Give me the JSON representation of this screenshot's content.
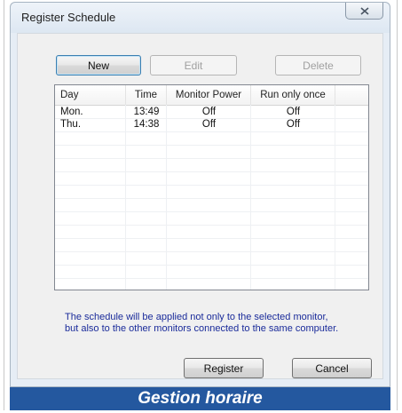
{
  "window": {
    "title": "Register Schedule"
  },
  "toolbar": {
    "new_label": "New",
    "edit_label": "Edit",
    "delete_label": "Delete"
  },
  "schedule_table": {
    "columns": [
      "Day",
      "Time",
      "Monitor Power",
      "Run only once"
    ],
    "rows": [
      {
        "day": "Mon.",
        "time": "13:49",
        "monitor_power": "Off",
        "run_only_once": "Off"
      },
      {
        "day": "Thu.",
        "time": "14:38",
        "monitor_power": "Off",
        "run_only_once": "Off"
      }
    ]
  },
  "note": {
    "line1": "The schedule will be applied not only to the selected monitor,",
    "line2": "but also to the other monitors connected to the same computer."
  },
  "footer": {
    "register_label": "Register",
    "cancel_label": "Cancel"
  },
  "banner": {
    "caption": "Gestion horaire"
  },
  "colors": {
    "note_text": "#1a2b9a",
    "banner_background": "#24589f"
  },
  "icons": {
    "close": "close-icon"
  }
}
